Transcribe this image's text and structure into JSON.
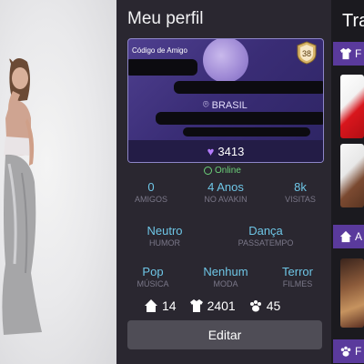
{
  "profile": {
    "title": "Meu perfil",
    "card": {
      "friend_code_label": "Código de Amigo",
      "level": "38",
      "country": "BRASIL",
      "gems": "3413"
    },
    "status": "Online",
    "stats": [
      {
        "value": "0",
        "label": "AMIGOS"
      },
      {
        "value": "4 Anos",
        "label": "NO AVAKIN"
      },
      {
        "value": "8k",
        "label": "VISITAS"
      }
    ],
    "interests_row1": [
      {
        "value": "Neutro",
        "label": "HUMOR"
      },
      {
        "value": "Dança",
        "label": "PASSATEMPO"
      }
    ],
    "interests_row2": [
      {
        "value": "Pop",
        "label": "MÚSICA"
      },
      {
        "value": "Nenhum",
        "label": "MODA"
      },
      {
        "value": "Terror",
        "label": "FILMES"
      }
    ],
    "counts": {
      "homes": "14",
      "outfits": "2401",
      "pets": "45"
    },
    "edit_label": "Editar"
  },
  "right": {
    "title": "Tra",
    "section_letter": "F",
    "section2_letter": "A",
    "section3_letter": "F"
  },
  "colors": {
    "accent": "#6ec6e6",
    "online": "#6cd07a",
    "purple": "#5a3a9c"
  }
}
